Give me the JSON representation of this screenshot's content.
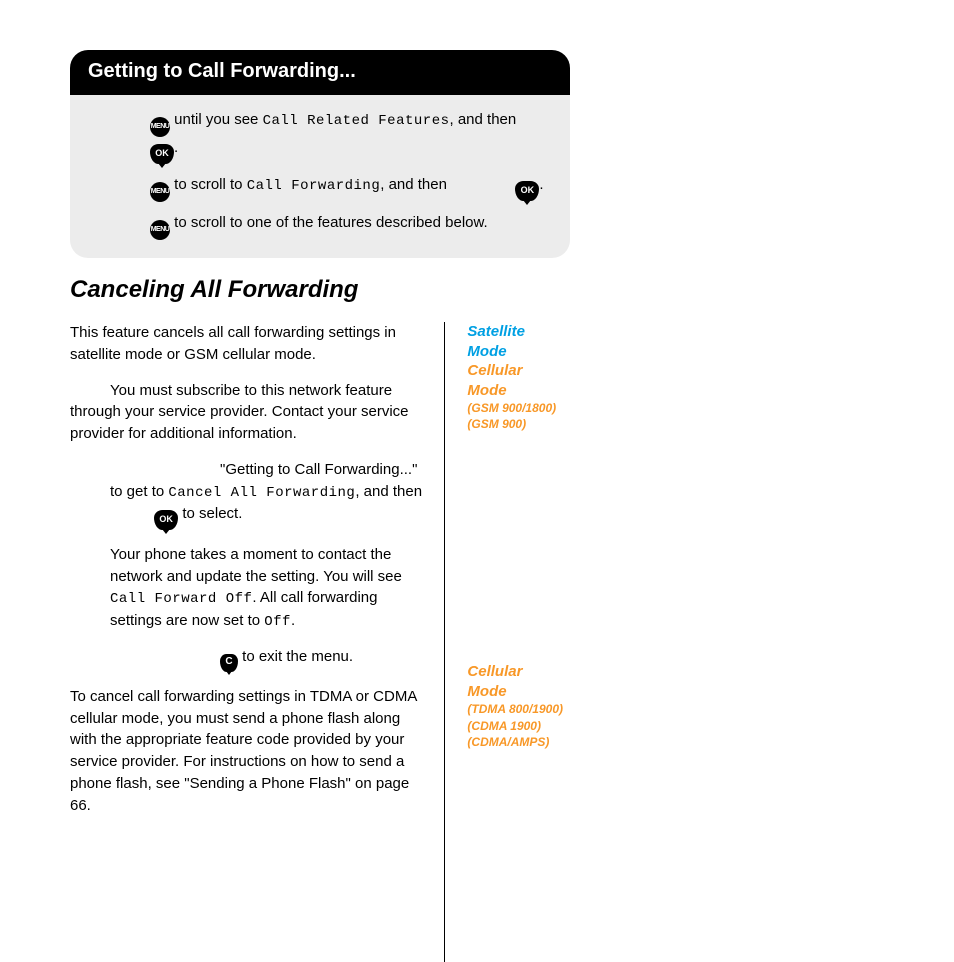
{
  "box": {
    "title": "Getting to Call Forwarding...",
    "s1a": " until you see ",
    "s1b": "Call Related Features",
    "s1c": ", and then ",
    "s1d": ".",
    "s2a": " to scroll to ",
    "s2b": "Call Forwarding",
    "s2c": ", and then ",
    "s2d": ".",
    "s3": " to scroll to one of the features described below."
  },
  "section_title": "Canceling All Forwarding",
  "p1": "This feature cancels all call forwarding settings in satellite mode or GSM cellular mode.",
  "p2": "You must subscribe to this network feature through your service provider. Contact your service provider for additional information.",
  "p3a": "\"Getting to Call Forwarding...\" to get to ",
  "p3b": "Cancel All Forwarding",
  "p3c": ", and then ",
  "p3d": " to select.",
  "p4a": "Your phone takes a moment to contact the network and update the setting. You will see ",
  "p4b": "Call Forward Off",
  "p4c": ". All call forwarding settings are now set to ",
  "p4d": "Off",
  "p4e": ".",
  "p5": " to exit the menu.",
  "p6": "To cancel call forwarding settings in TDMA or CDMA cellular mode, you must send a phone flash along with the appropriate feature code provided by your service provider. For instructions on how to send a phone flash, see \"Sending a Phone Flash\" on page 66.",
  "side": {
    "sat": "Satellite Mode",
    "cell1": "Cellular Mode",
    "cell1_sub1": "(GSM 900/1800)",
    "cell1_sub2": "(GSM 900)",
    "cell2": "Cellular Mode",
    "cell2_sub1": "(TDMA 800/1900)",
    "cell2_sub2": "(CDMA 1900)",
    "cell2_sub3": "(CDMA/AMPS)"
  },
  "icons": {
    "menu": "MENU",
    "ok": "OK",
    "c": "C"
  }
}
